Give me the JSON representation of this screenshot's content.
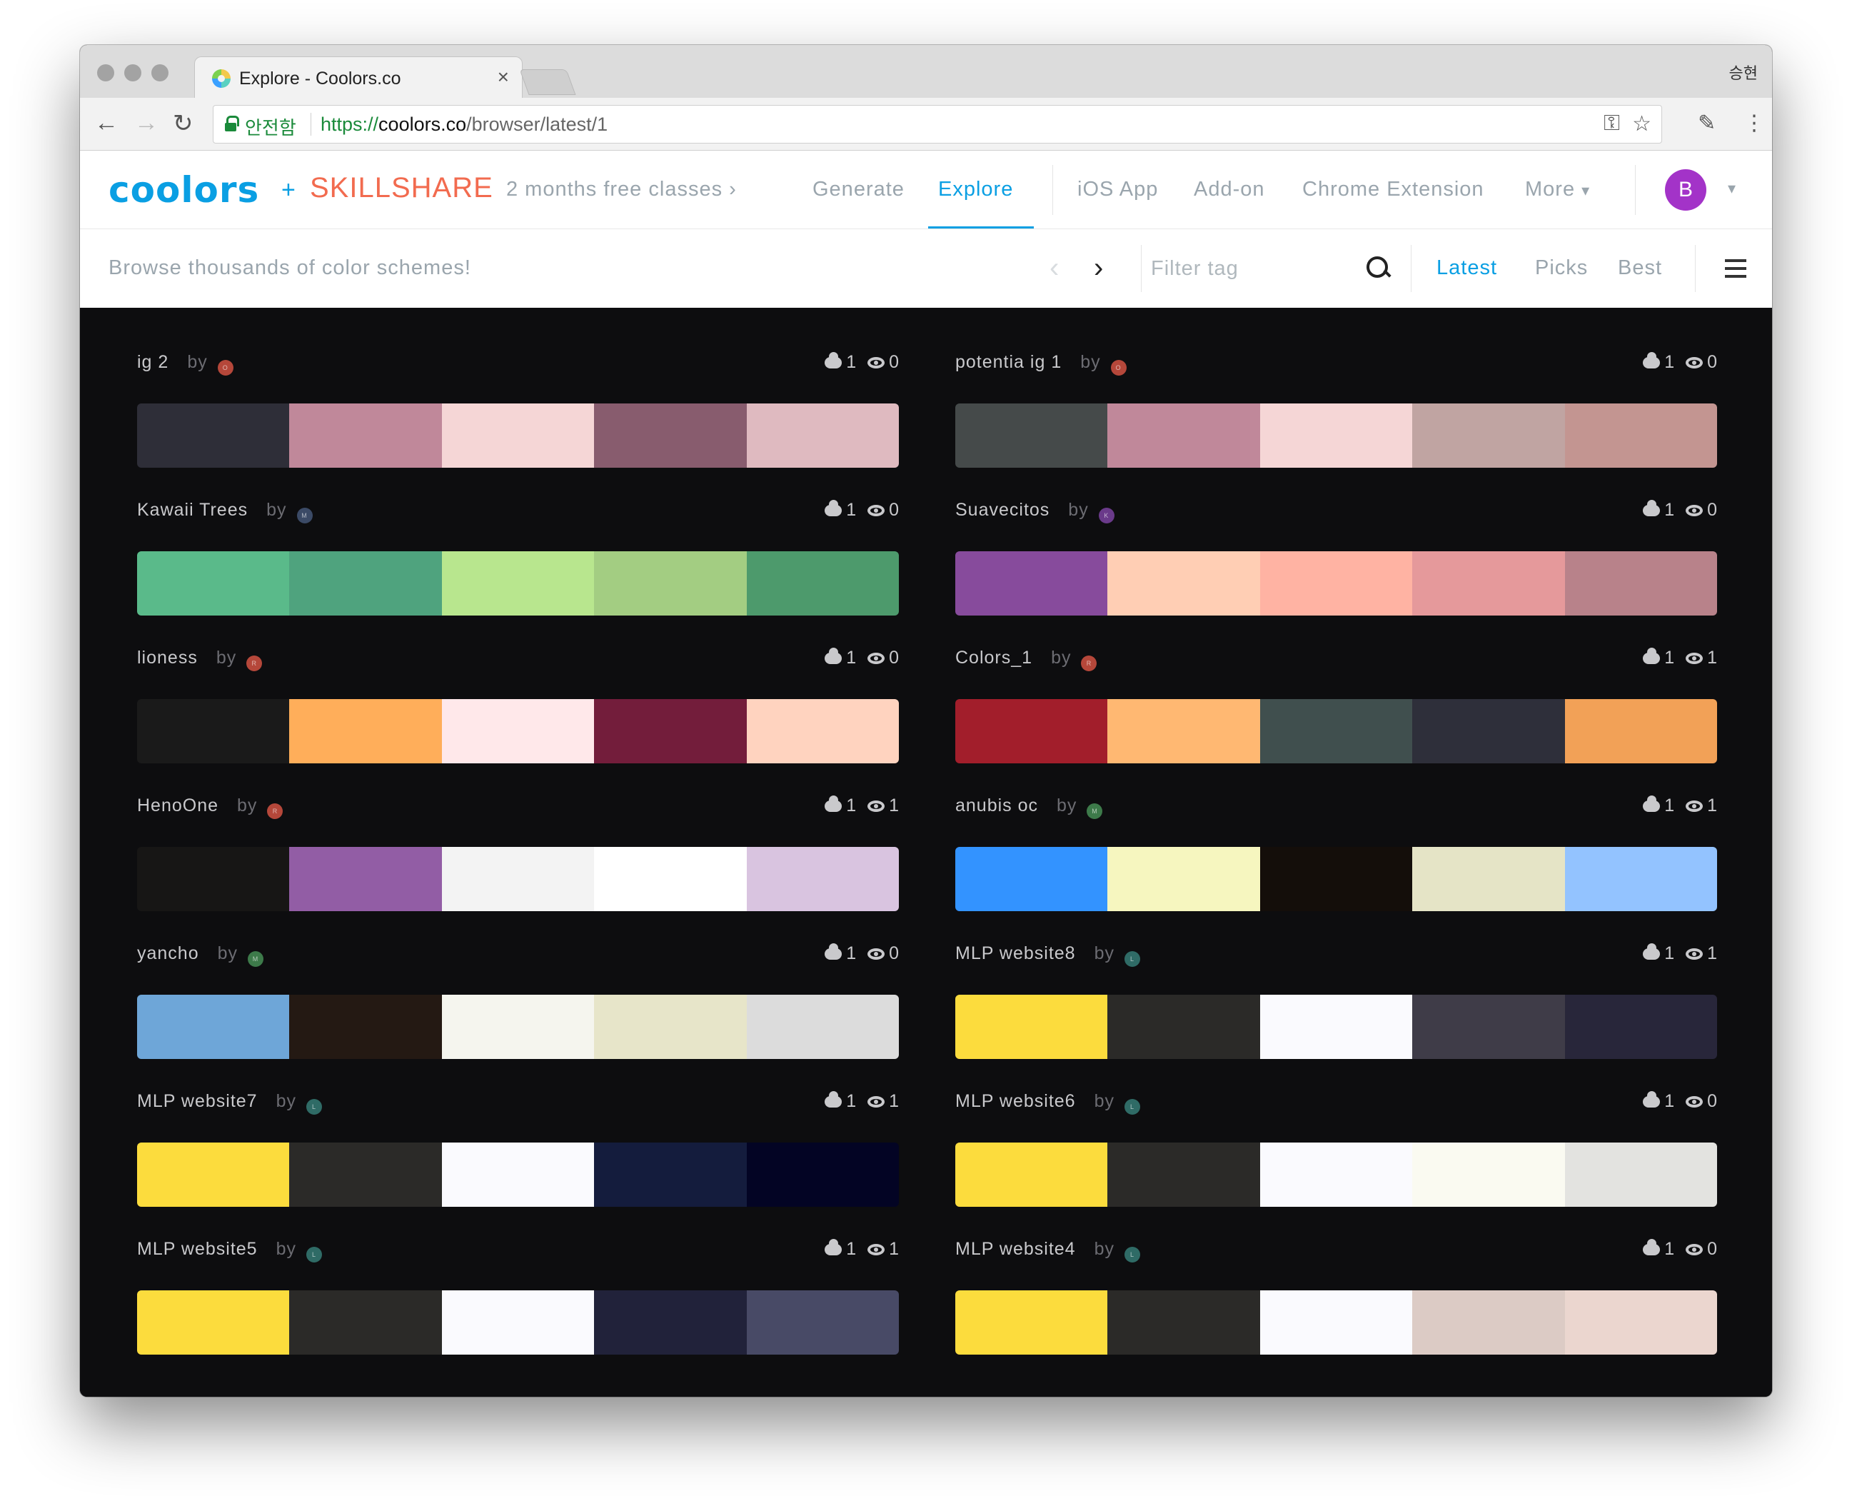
{
  "browser": {
    "tab_title": "Explore - Coolors.co",
    "tab_close": "×",
    "profile_name": "승현",
    "secure_label": "안전함",
    "url_scheme": "https://",
    "url_host": "coolors.co",
    "url_path": "/browser/latest/1"
  },
  "sitenav": {
    "logo": "coolors",
    "plus": "+",
    "partner": "SKILLSHARE",
    "promo": "2 months free classes",
    "links": [
      "Generate",
      "Explore",
      "iOS App",
      "Add-on",
      "Chrome Extension",
      "More"
    ],
    "active_link": "Explore",
    "avatar_initial": "B"
  },
  "subbar": {
    "tagline": "Browse thousands of color schemes!",
    "filter_placeholder": "Filter tag",
    "sort_links": [
      "Latest",
      "Picks",
      "Best"
    ],
    "active_sort": "Latest"
  },
  "palettes": [
    {
      "name": "ig 2",
      "by": "by",
      "author_initial": "O",
      "author_color": "#b5473a",
      "saves": "1",
      "views": "0",
      "colors": [
        "#2e2e38",
        "#c0889a",
        "#f5d6d6",
        "#885c6e",
        "#dfbac0"
      ]
    },
    {
      "name": "potentia ig 1",
      "by": "by",
      "author_initial": "O",
      "author_color": "#b5473a",
      "saves": "1",
      "views": "0",
      "colors": [
        "#454a4a",
        "#c0889a",
        "#f5d6d6",
        "#c0a4a2",
        "#c39591"
      ]
    },
    {
      "name": "Kawaii Trees",
      "by": "by",
      "author_initial": "M",
      "author_color": "#3b4a66",
      "saves": "1",
      "views": "0",
      "colors": [
        "#5aba8a",
        "#4fa37e",
        "#b8e68e",
        "#a3cd82",
        "#4d9a6c"
      ]
    },
    {
      "name": "Suavecitos",
      "by": "by",
      "author_initial": "K",
      "author_color": "#6a3a8a",
      "saves": "1",
      "views": "0",
      "colors": [
        "#874b9c",
        "#ffceb4",
        "#ffb3a3",
        "#e5999b",
        "#b8828a"
      ]
    },
    {
      "name": "lioness",
      "by": "by",
      "author_initial": "R",
      "author_color": "#b5473a",
      "saves": "1",
      "views": "0",
      "colors": [
        "#1a1a1a",
        "#ffae5a",
        "#ffe8ea",
        "#731d3b",
        "#ffd3bf"
      ]
    },
    {
      "name": "Colors_1",
      "by": "by",
      "author_initial": "R",
      "author_color": "#b5473a",
      "saves": "1",
      "views": "1",
      "colors": [
        "#a21e2b",
        "#ffb872",
        "#404f4e",
        "#2e2f3a",
        "#f2a157"
      ]
    },
    {
      "name": "HenoOne",
      "by": "by",
      "author_initial": "R",
      "author_color": "#b5473a",
      "saves": "1",
      "views": "1",
      "colors": [
        "#171615",
        "#925da5",
        "#f3f3f3",
        "#ffffff",
        "#d9c4e0"
      ]
    },
    {
      "name": "anubis oc",
      "by": "by",
      "author_initial": "M",
      "author_color": "#3d7a4a",
      "saves": "1",
      "views": "1",
      "colors": [
        "#3393ff",
        "#f6f6bf",
        "#140e0a",
        "#e5e4c6",
        "#93c3ff"
      ]
    },
    {
      "name": "yancho",
      "by": "by",
      "author_initial": "M",
      "author_color": "#3d7a4a",
      "saves": "1",
      "views": "0",
      "colors": [
        "#6ea6d8",
        "#241913",
        "#f5f5ee",
        "#e7e5c9",
        "#dcdcdc"
      ]
    },
    {
      "name": "MLP website8",
      "by": "by",
      "author_initial": "L",
      "author_color": "#2f6b66",
      "saves": "1",
      "views": "1",
      "colors": [
        "#fcdc3d",
        "#2b2a28",
        "#fafafe",
        "#3f3c48",
        "#28263a"
      ]
    },
    {
      "name": "MLP website7",
      "by": "by",
      "author_initial": "L",
      "author_color": "#2f6b66",
      "saves": "1",
      "views": "1",
      "colors": [
        "#fcdc3d",
        "#2b2a28",
        "#fafafe",
        "#141c3d",
        "#030424"
      ]
    },
    {
      "name": "MLP website6",
      "by": "by",
      "author_initial": "L",
      "author_color": "#2f6b66",
      "saves": "1",
      "views": "0",
      "colors": [
        "#fcdc3d",
        "#2b2a28",
        "#fafafe",
        "#fafaf1",
        "#e3e3e0"
      ]
    },
    {
      "name": "MLP website5",
      "by": "by",
      "author_initial": "L",
      "author_color": "#2f6b66",
      "saves": "1",
      "views": "1",
      "colors": [
        "#fcdc3d",
        "#2b2a28",
        "#fafafe",
        "#21223a",
        "#484a66"
      ]
    },
    {
      "name": "MLP website4",
      "by": "by",
      "author_initial": "L",
      "author_color": "#2f6b66",
      "saves": "1",
      "views": "0",
      "colors": [
        "#fcdc3d",
        "#2b2a28",
        "#fafafe",
        "#dccbc5",
        "#ebd6cf"
      ]
    }
  ],
  "colors": {
    "accent": "#0a9fe3",
    "skillshare": "#f26b4f",
    "background": "#0d0d0f"
  }
}
